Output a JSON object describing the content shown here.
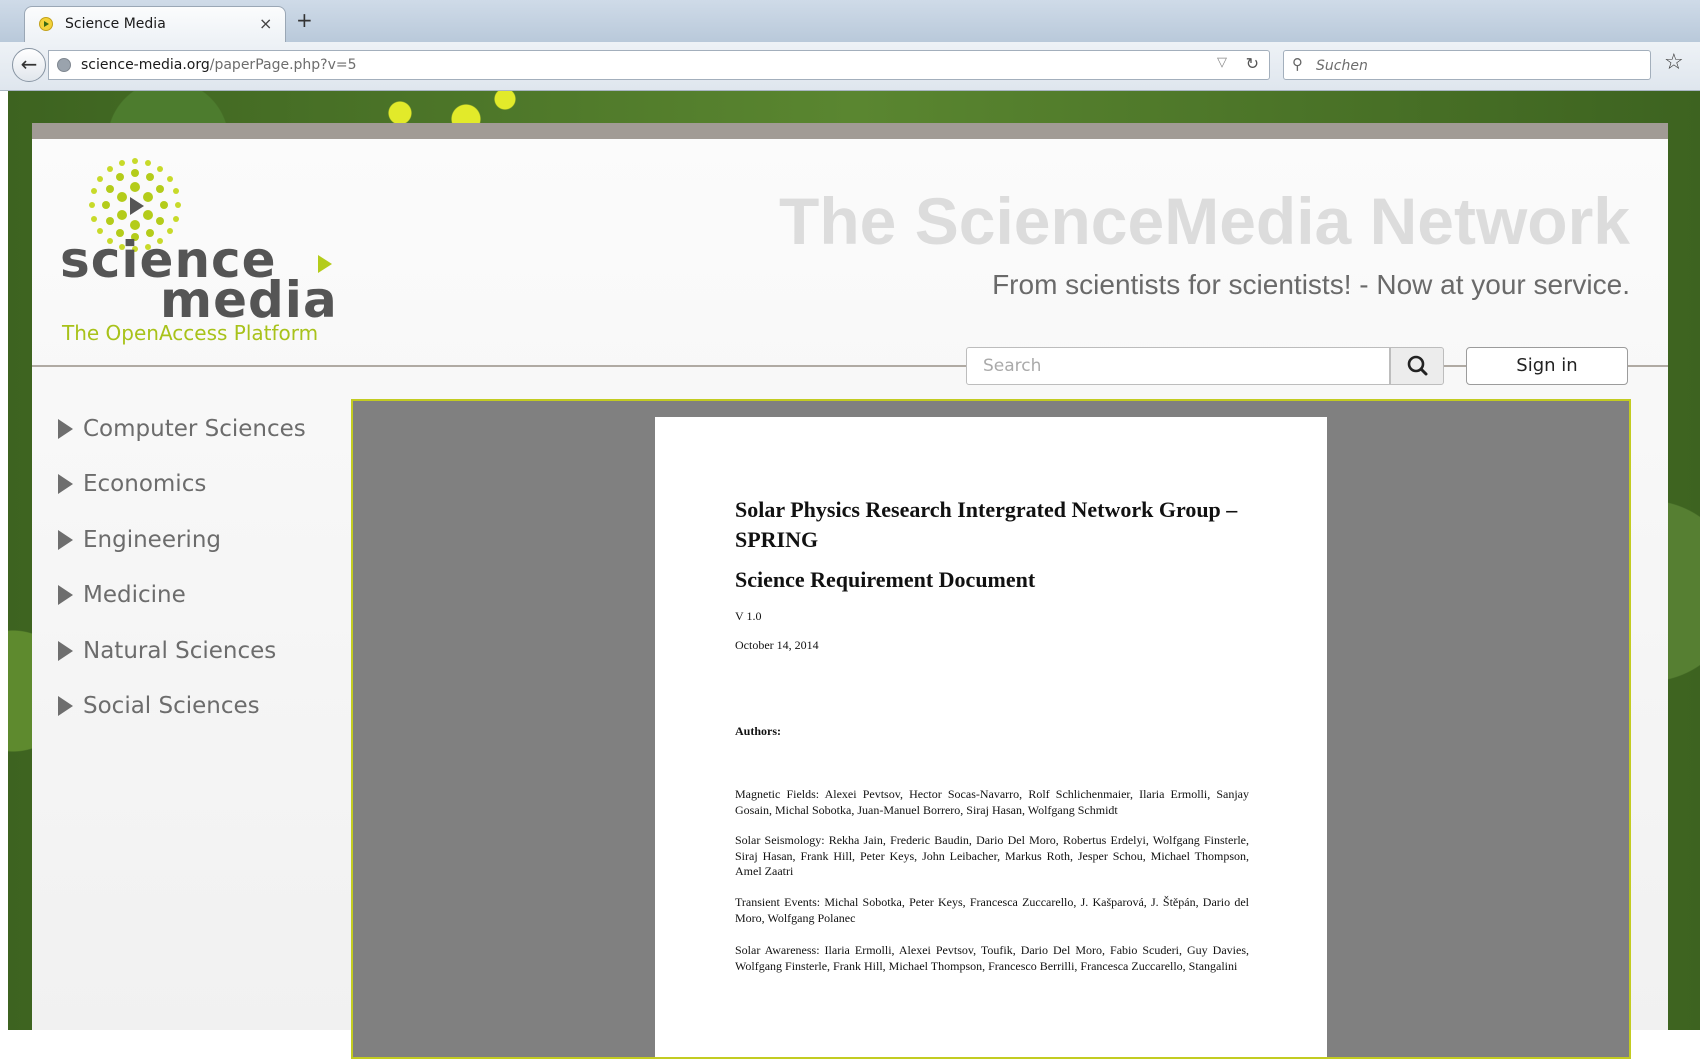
{
  "browser": {
    "tab_title": "Science Media",
    "tab_close": "×",
    "new_tab": "+",
    "url_host": "science-media.org",
    "url_path": "/paperPage.php?v=5",
    "search_placeholder": "Suchen"
  },
  "site": {
    "logo_science": "science",
    "logo_media": "media",
    "logo_tagline": "The OpenAccess Platform",
    "headline": "The ScienceMedia Network",
    "subheadline": "From scientists for scientists! - Now at your service.",
    "search_placeholder": "Search",
    "sign_in": "Sign in"
  },
  "sidebar": {
    "items": [
      {
        "label": "Computer Sciences"
      },
      {
        "label": "Economics"
      },
      {
        "label": "Engineering"
      },
      {
        "label": "Medicine"
      },
      {
        "label": "Natural Sciences"
      },
      {
        "label": "Social Sciences"
      }
    ]
  },
  "document": {
    "title": "Solar Physics Research Intergrated Network Group – SPRING",
    "subtitle": "Science Requirement Document",
    "version": "V 1.0",
    "date": "October 14, 2014",
    "authors_heading": "Authors:",
    "paragraphs": [
      "Magnetic Fields: Alexei Pevtsov, Hector Socas-Navarro, Rolf Schlichenmaier, Ilaria Ermolli, Sanjay Gosain, Michal Sobotka, Juan-Manuel Borrero, Siraj Hasan, Wolfgang Schmidt",
      "Solar Seismology: Rekha Jain, Frederic Baudin, Dario Del Moro, Robertus Erdelyi, Wolfgang Finsterle, Siraj Hasan, Frank Hill, Peter Keys, John Leibacher, Markus Roth, Jesper Schou, Michael Thompson, Amel Zaatri",
      "Transient Events: Michal Sobotka, Peter Keys, Francesca Zuccarello, J. Kašparová, J. Štěpán, Dario del Moro, Wolfgang Polanec",
      "Solar Awareness: Ilaria Ermolli, Alexei Pevtsov, Toufik, Dario Del Moro, Fabio Scuderi, Guy Davies, Wolfgang Finsterle, Frank Hill, Michael Thompson, Francesco Berrilli, Francesca Zuccarello, Stangalini"
    ]
  },
  "colors": {
    "accent_green": "#b4cc1a",
    "viewer_border": "#c3cc21",
    "viewer_bg": "#808080"
  },
  "icons": [
    "favicon-icon",
    "back-arrow-icon",
    "globe-icon",
    "dropdown-icon",
    "reload-icon",
    "search-icon",
    "star-icon",
    "search-magnifier-icon",
    "play-icon",
    "triangle-right-icon"
  ]
}
